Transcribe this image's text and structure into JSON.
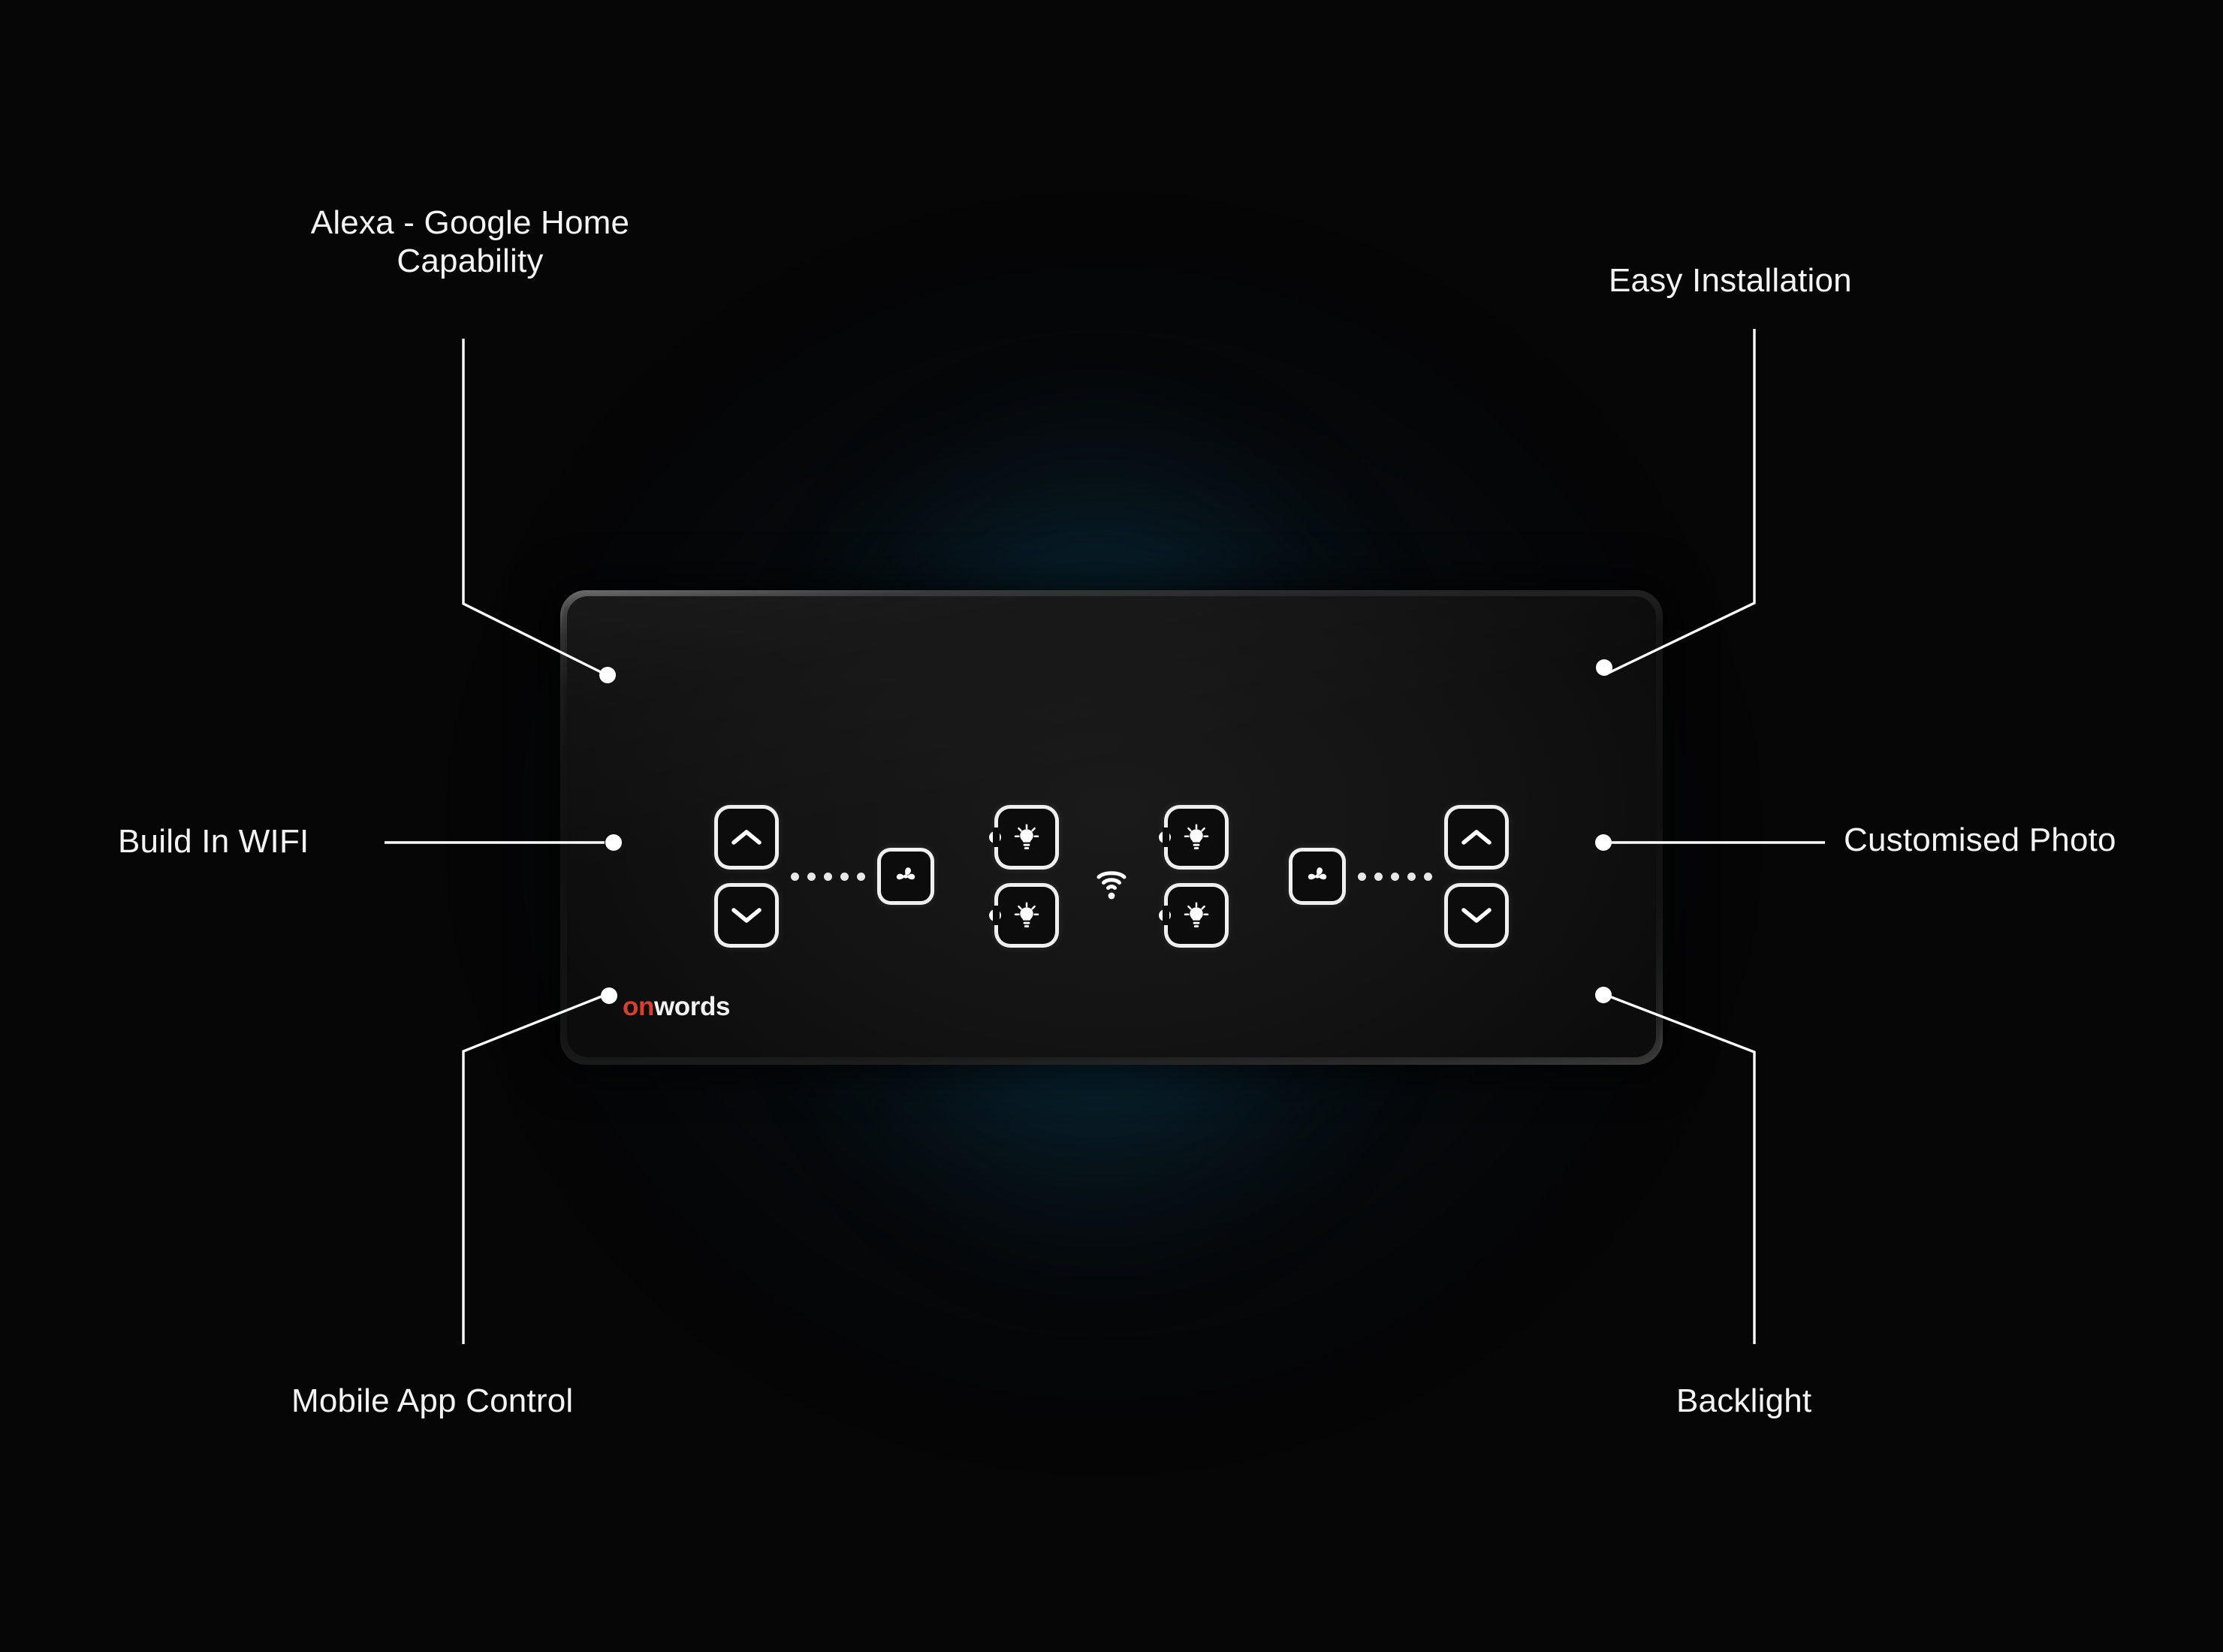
{
  "product": {
    "brand_on": "on",
    "brand_words": "words",
    "brand_color_accent": "#d6402e",
    "brand_color_text": "#f2f2f2",
    "glow_color": "#187498",
    "background_color": "#060607"
  },
  "callouts": [
    {
      "id": "alexa",
      "label": "Alexa - Google Home\nCapability",
      "side": "left"
    },
    {
      "id": "easy",
      "label": "Easy Installation",
      "side": "right"
    },
    {
      "id": "wifi",
      "label": "Build In WIFI",
      "side": "left"
    },
    {
      "id": "photo",
      "label": "Customised Photo",
      "side": "right"
    },
    {
      "id": "mobile",
      "label": "Mobile App Control",
      "side": "left"
    },
    {
      "id": "backlight",
      "label": "Backlight",
      "side": "right"
    }
  ],
  "panel": {
    "controls": {
      "fan_left": {
        "up_icon": "chevron-up-icon",
        "down_icon": "chevron-down-icon",
        "fan_icon": "fan-icon",
        "indicator_dots": 5
      },
      "lights_left": {
        "top_icon": "bulb-icon",
        "bottom_icon": "bulb-icon"
      },
      "wifi_indicator": {
        "icon": "wifi-icon"
      },
      "lights_right": {
        "top_icon": "bulb-icon",
        "bottom_icon": "bulb-icon"
      },
      "fan_right": {
        "up_icon": "chevron-up-icon",
        "down_icon": "chevron-down-icon",
        "fan_icon": "fan-icon",
        "indicator_dots": 5
      }
    }
  }
}
